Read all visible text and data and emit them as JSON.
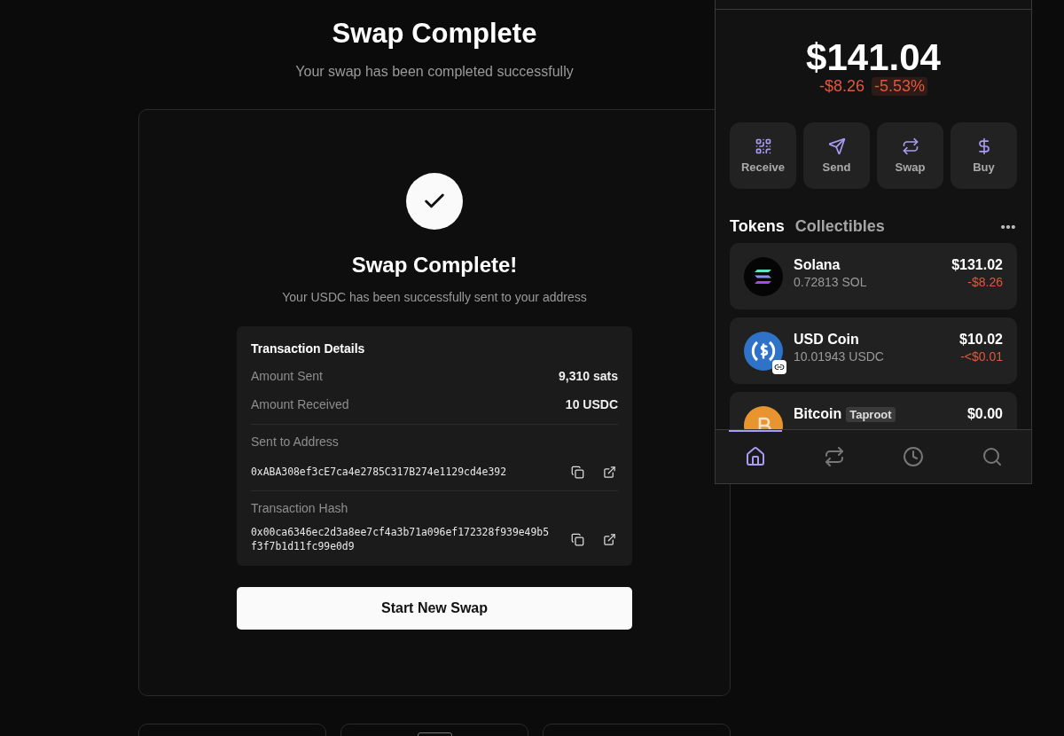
{
  "page": {
    "title": "Swap Complete",
    "subtitle": "Your swap has been completed successfully"
  },
  "result": {
    "title": "Swap Complete!",
    "message": "Your USDC has been successfully sent to your address",
    "details": {
      "title": "Transaction Details",
      "amounts": [
        {
          "label": "Amount Sent",
          "value": "9,310 sats"
        },
        {
          "label": "Amount Received",
          "value": "10 USDC"
        }
      ],
      "addresses": [
        {
          "label": "Sent to Address",
          "value": "0xABA308ef3cE7ca4e2785C317B274e1129cd4e392"
        },
        {
          "label": "Transaction Hash",
          "value": "0x00ca6346ec2d3a8ee7cf4a3b71a096ef172328f939e49b5f3f7b1d11fc99e0d9"
        }
      ]
    },
    "button": "Start New Swap"
  },
  "wallet": {
    "balance": "$141.04",
    "change": "-$8.26",
    "change_percent": "-5.53%",
    "actions": [
      {
        "kind": "qr",
        "label": "Receive"
      },
      {
        "kind": "send",
        "label": "Send"
      },
      {
        "kind": "swap",
        "label": "Swap"
      },
      {
        "kind": "dollar",
        "label": "Buy"
      }
    ],
    "tabs": [
      {
        "label": "Tokens",
        "selected": true
      },
      {
        "label": "Collectibles",
        "selected": false
      }
    ],
    "tokens": [
      {
        "kind": "solana",
        "name": "Solana",
        "amount": "0.72813 SOL",
        "value": "$131.02",
        "change": "-$8.26"
      },
      {
        "kind": "usdc",
        "name": "USD Coin",
        "amount": "10.01943 USDC",
        "value": "$10.02",
        "change": "-<$0.01"
      },
      {
        "kind": "bitcoin",
        "name": "Bitcoin",
        "badge": "Taproot",
        "value": "$0.00"
      }
    ],
    "nav": [
      {
        "kind": "home",
        "selected": true
      },
      {
        "kind": "swap",
        "selected": false
      },
      {
        "kind": "history",
        "selected": false
      },
      {
        "kind": "search",
        "selected": false
      }
    ]
  }
}
